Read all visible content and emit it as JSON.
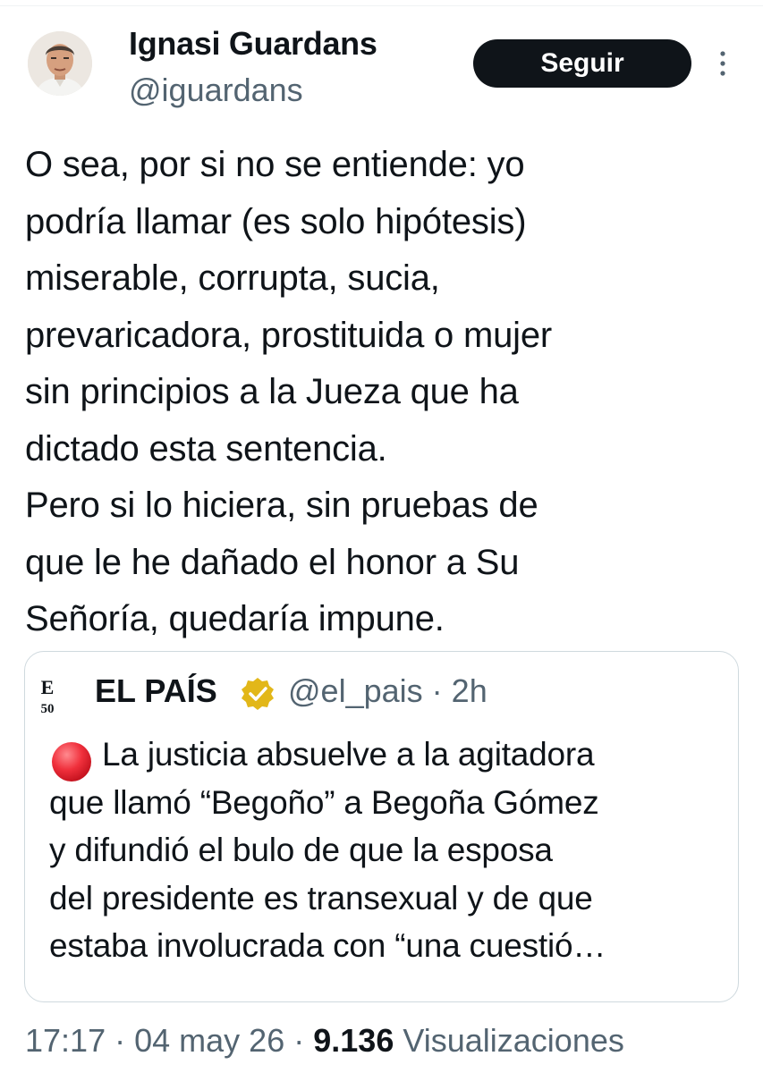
{
  "author": {
    "name": "Ignasi Guardans",
    "handle": "@iguardans"
  },
  "follow_button": "Seguir",
  "more_icon": "more-vertical-icon",
  "tweet_lines": [
    "O sea, por si no se entiende: yo",
    "podría llamar (es solo hipótesis)",
    "miserable, corrupta, sucia,",
    "prevaricadora, prostituida o mujer",
    "sin principios a la Jueza que ha",
    "dictado esta sentencia.",
    "Pero si lo hiciera, sin pruebas de",
    "que le he dañado el honor a Su",
    "Señoría, quedaría impune."
  ],
  "quote": {
    "logo_text": {
      "top": "E",
      "bottom": "50"
    },
    "name": "EL PAÍS",
    "verified_icon": "verified-gold-badge-icon",
    "handle": "@el_pais",
    "separator": "·",
    "time": "2h",
    "emoji_icon": "red-circle-icon",
    "lines": [
      "La justicia absuelve a la agitadora",
      "que llamó “Begoño” a Begoña Gómez",
      "y difundió el bulo de que la esposa",
      "del presidente es transexual y de que",
      "estaba involucrada con “una cuestió…"
    ]
  },
  "meta": {
    "time": "17:17",
    "separator": "·",
    "date": "04 may 26",
    "views_count": "9.136",
    "views_label": "Visualizaciones"
  },
  "colors": {
    "text": "#0f1419",
    "secondary": "#536471",
    "border": "#cfd9de",
    "button_bg": "#0f1419",
    "verified_gold": "#e2b719",
    "red_emoji": "#f0303c"
  }
}
